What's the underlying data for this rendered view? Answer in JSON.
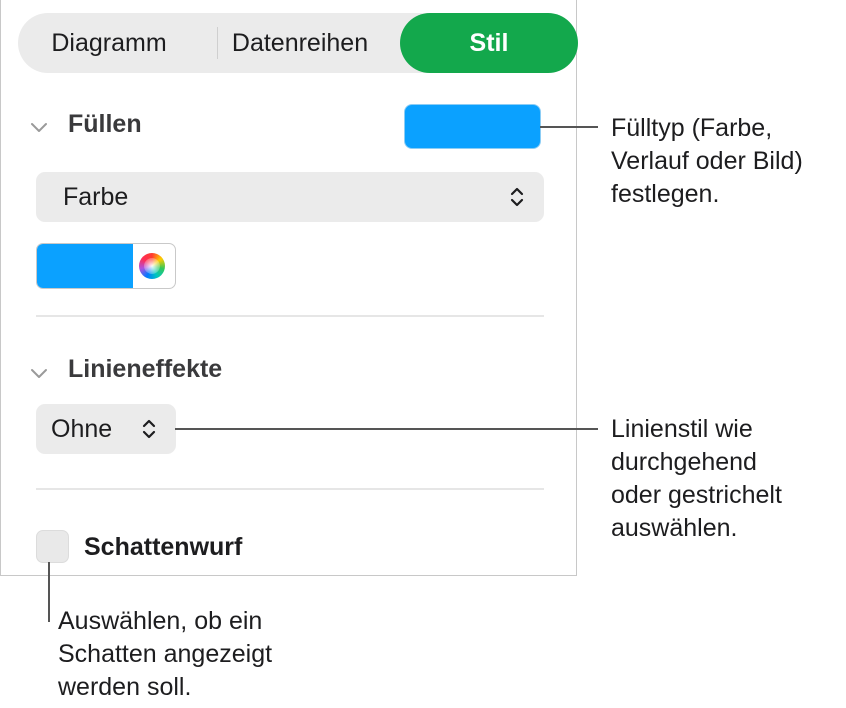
{
  "tabs": [
    {
      "label": "Diagramm",
      "selected": false
    },
    {
      "label": "Datenreihen",
      "selected": false
    },
    {
      "label": "Stil",
      "selected": true
    }
  ],
  "accent_color": "#13a84c",
  "fill_section": {
    "title": "Füllen",
    "fill_color": "#0ba1ff",
    "fill_type_value": "Farbe"
  },
  "line_section": {
    "title": "Linieneffekte",
    "line_style_value": "Ohne"
  },
  "shadow": {
    "label": "Schattenwurf",
    "checked": false
  },
  "callouts": {
    "fill_type": [
      "Fülltyp (Farbe,",
      "Verlauf oder Bild)",
      "festlegen."
    ],
    "line_style": [
      "Linienstil wie",
      "durchgehend",
      "oder gestrichelt",
      "auswählen."
    ],
    "shadow": [
      "Auswählen, ob ein",
      "Schatten angezeigt",
      "werden soll."
    ]
  }
}
